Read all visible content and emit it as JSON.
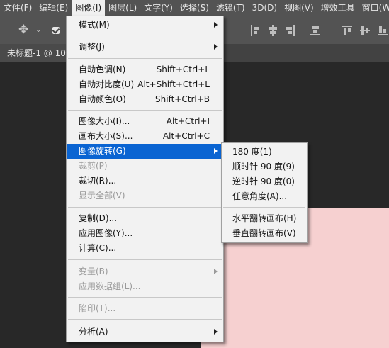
{
  "menubar": {
    "items": [
      {
        "label": "文件(F)"
      },
      {
        "label": "编辑(E)"
      },
      {
        "label": "图像(I)"
      },
      {
        "label": "图层(L)"
      },
      {
        "label": "文字(Y)"
      },
      {
        "label": "选择(S)"
      },
      {
        "label": "滤镜(T)"
      },
      {
        "label": "3D(D)"
      },
      {
        "label": "视图(V)"
      },
      {
        "label": "增效工具"
      },
      {
        "label": "窗口(W)"
      }
    ],
    "active_index": 2
  },
  "document": {
    "tab_title": "未标题-1 @ 10"
  },
  "colors": {
    "canvas": "#f6d0d0",
    "highlight": "#0a64d2"
  },
  "image_menu": {
    "mode": "模式(M)",
    "adjustments": "调整(J)",
    "auto_tone": {
      "label": "自动色调(N)",
      "shortcut": "Shift+Ctrl+L"
    },
    "auto_contrast": {
      "label": "自动对比度(U)",
      "shortcut": "Alt+Shift+Ctrl+L"
    },
    "auto_color": {
      "label": "自动颜色(O)",
      "shortcut": "Shift+Ctrl+B"
    },
    "image_size": {
      "label": "图像大小(I)...",
      "shortcut": "Alt+Ctrl+I"
    },
    "canvas_size": {
      "label": "画布大小(S)...",
      "shortcut": "Alt+Ctrl+C"
    },
    "rotation": "图像旋转(G)",
    "crop": "裁剪(P)",
    "trim": "裁切(R)...",
    "reveal_all": "显示全部(V)",
    "duplicate": "复制(D)...",
    "apply_image": "应用图像(Y)...",
    "calculations": "计算(C)...",
    "variables": "变量(B)",
    "apply_data_set": "应用数据组(L)...",
    "trap": "陷印(T)...",
    "analysis": "分析(A)"
  },
  "rotation_submenu": {
    "r180": "180 度(1)",
    "cw90": "顺时针 90 度(9)",
    "ccw90": "逆时针 90 度(0)",
    "arbitrary": "任意角度(A)...",
    "flip_h": "水平翻转画布(H)",
    "flip_v": "垂直翻转画布(V)"
  }
}
